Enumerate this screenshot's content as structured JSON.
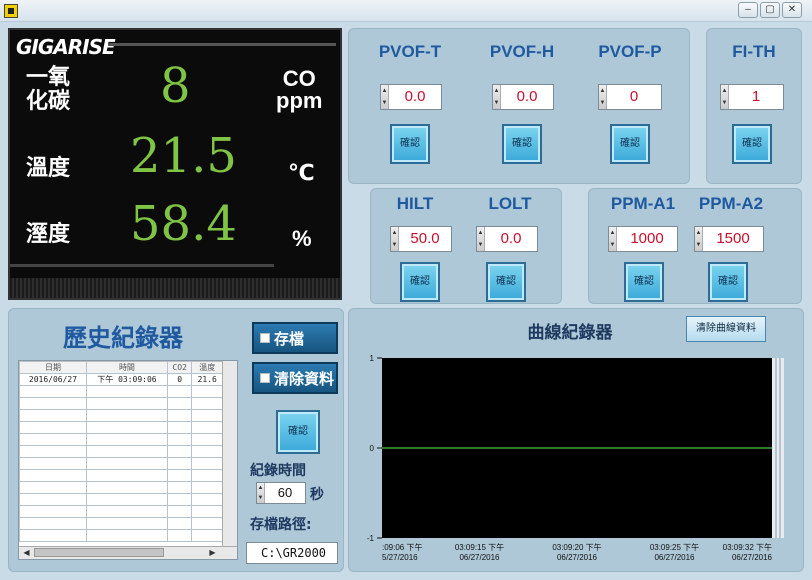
{
  "window": {
    "minimize_label": "–",
    "maximize_label": "▢",
    "close_label": "✕"
  },
  "display": {
    "logo": "GIGARISE",
    "co_label_line1": "一氧",
    "co_label_line2": "化碳",
    "co_value": "8",
    "co_unit_line1": "CO",
    "co_unit_line2": "ppm",
    "temp_label": "溫度",
    "temp_value": "21.5",
    "temp_unit": "℃",
    "humidity_label": "溼度",
    "humidity_value": "58.4",
    "humidity_unit": "%"
  },
  "settings": {
    "confirm_label": "確認",
    "pvof_t": {
      "label": "PVOF-T",
      "value": "0.0"
    },
    "pvof_h": {
      "label": "PVOF-H",
      "value": "0.0"
    },
    "pvof_p": {
      "label": "PVOF-P",
      "value": "0"
    },
    "fi_th": {
      "label": "FI-TH",
      "value": "1"
    },
    "hilt": {
      "label": "HILT",
      "value": "50.0"
    },
    "lolt": {
      "label": "LOLT",
      "value": "0.0"
    },
    "ppm_a1": {
      "label": "PPM-A1",
      "value": "1000"
    },
    "ppm_a2": {
      "label": "PPM-A2",
      "value": "1500"
    }
  },
  "history": {
    "title": "歷史紀錄器",
    "columns": [
      "日期",
      "時間",
      "CO2",
      "溫度"
    ],
    "rows": [
      [
        "2016/06/27",
        "下午 03:09:06",
        "0",
        "21.6"
      ]
    ],
    "save_button": "存檔",
    "clear_button": "清除資料",
    "confirm_label": "確認",
    "record_time_label": "紀錄時間",
    "record_time_value": "60",
    "record_time_unit": "秒",
    "save_path_label": "存檔路徑:",
    "save_path_value": "C:\\GR2000"
  },
  "chart": {
    "title": "曲線紀錄器",
    "clear_button": "清除曲線資料"
  },
  "chart_data": {
    "type": "line",
    "title": "曲線紀錄器",
    "xlabel": "",
    "ylabel": "",
    "ylim": [
      -1,
      1
    ],
    "yticks": [
      "1",
      "0",
      "-1"
    ],
    "xticks": [
      {
        "time": ":09:06 下午",
        "date": "5/27/2016"
      },
      {
        "time": "03:09:15 下午",
        "date": "06/27/2016"
      },
      {
        "time": "03:09:20 下午",
        "date": "06/27/2016"
      },
      {
        "time": "03:09:25 下午",
        "date": "06/27/2016"
      },
      {
        "time": "03:09:32 下午",
        "date": "06/27/2016"
      }
    ],
    "series": [
      {
        "values": [
          0,
          0,
          0,
          0,
          0
        ],
        "color": "#3fa040"
      }
    ],
    "background": "#000000",
    "grid": false
  },
  "colors": {
    "panel": "#aec8d8",
    "display_value": "#7fc445",
    "numeric_value": "#c8102e",
    "heading": "#1f5aa0"
  }
}
